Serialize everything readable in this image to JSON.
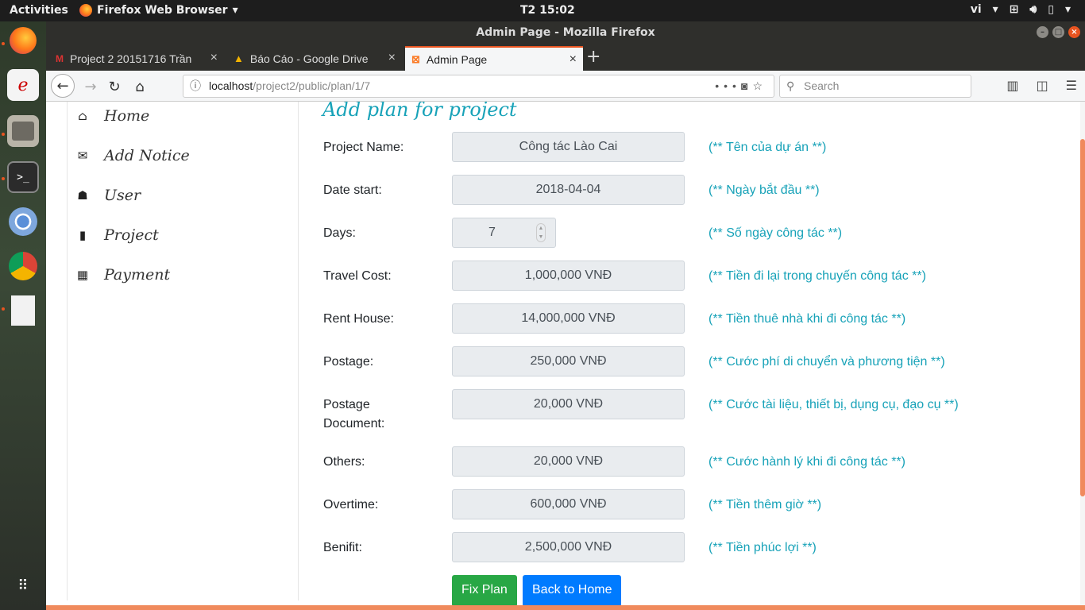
{
  "topbar": {
    "activities": "Activities",
    "app_name": "Firefox Web Browser",
    "clock": "T2 15:02",
    "lang": "vi"
  },
  "window": {
    "title": "Admin Page - Mozilla Firefox"
  },
  "tabs": [
    {
      "label": "Project 2 20151716 Trần",
      "icon": "gmail-icon"
    },
    {
      "label": "Báo Cáo - Google Drive",
      "icon": "drive-icon"
    },
    {
      "label": "Admin Page",
      "icon": "xampp-icon"
    }
  ],
  "navbar": {
    "url_host": "localhost",
    "url_path": "/project2/public/plan/1/7",
    "search_placeholder": "Search"
  },
  "sidebar": {
    "items": [
      {
        "label": "Home",
        "icon": "home-icon"
      },
      {
        "label": "Add Notice",
        "icon": "envelope-open-icon"
      },
      {
        "label": "User",
        "icon": "user-secret-icon"
      },
      {
        "label": "Project",
        "icon": "book-icon"
      },
      {
        "label": "Payment",
        "icon": "calculator-icon"
      }
    ]
  },
  "form": {
    "title": "Add plan for project",
    "fields": [
      {
        "label": "Project Name:",
        "value": "Công tác Lào Cai",
        "hint": "(** Tên của dự án **)"
      },
      {
        "label": "Date start:",
        "value": "2018-04-04",
        "hint": "(** Ngày bắt đầu **)"
      },
      {
        "label": "Days:",
        "value": "7",
        "hint": "(** Số ngày công tác **)"
      },
      {
        "label": "Travel Cost:",
        "value": "1,000,000 VNĐ",
        "hint": "(** Tiền đi lại trong chuyến công tác **)"
      },
      {
        "label": "Rent House:",
        "value": "14,000,000 VNĐ",
        "hint": "(** Tiền thuê nhà khi đi công tác **)"
      },
      {
        "label": "Postage:",
        "value": "250,000 VNĐ",
        "hint": "(** Cước phí di chuyển và phương tiện **)"
      },
      {
        "label": "Postage Document:",
        "value": "20,000 VNĐ",
        "hint": "(** Cước tài liệu, thiết bị, dụng cụ, đạo cụ **)"
      },
      {
        "label": "Others:",
        "value": "20,000 VNĐ",
        "hint": "(** Cước hành lý khi đi công tác **)"
      },
      {
        "label": "Overtime:",
        "value": "600,000 VNĐ",
        "hint": "(** Tiền thêm giờ **)"
      },
      {
        "label": "Benifit:",
        "value": "2,500,000 VNĐ",
        "hint": "(** Tiền phúc lợi **)"
      }
    ],
    "fix_button": "Fix Plan",
    "back_button": "Back to Home"
  }
}
